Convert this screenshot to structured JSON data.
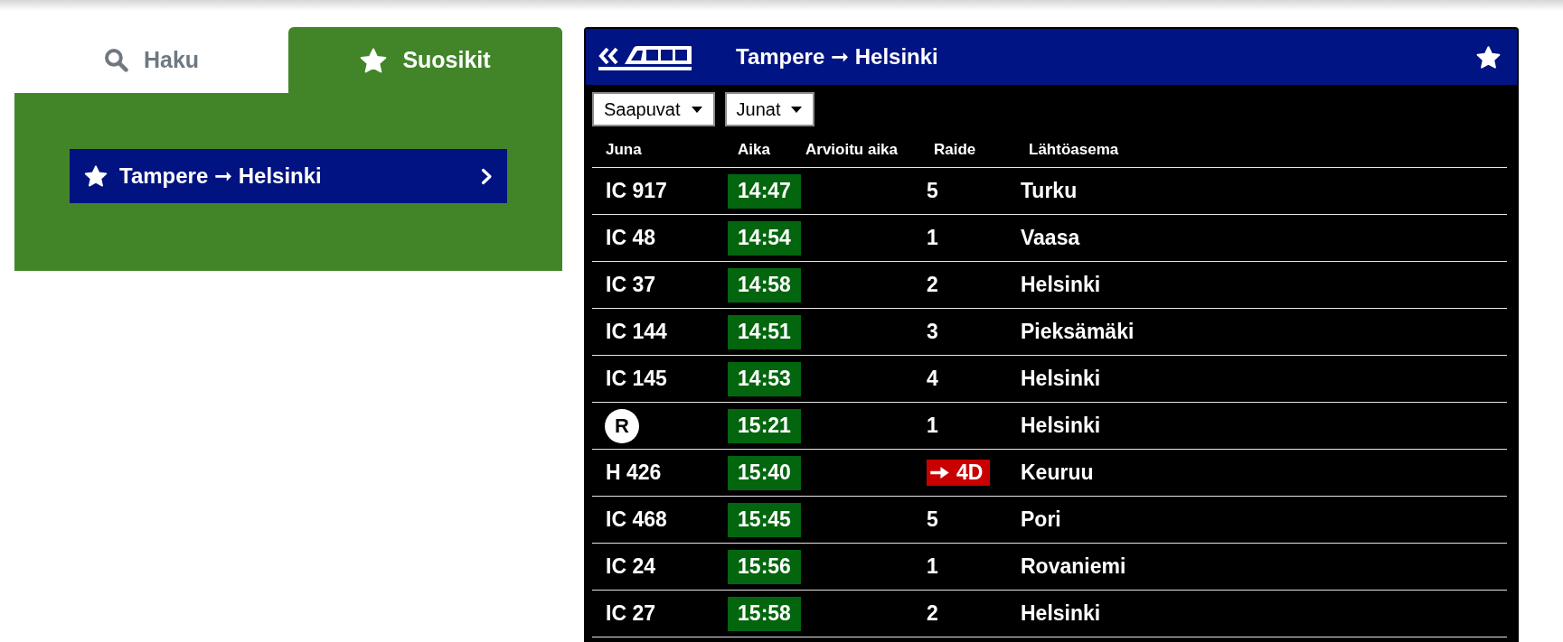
{
  "tabs": [
    {
      "label": "Haku",
      "kind": "search",
      "selected": false
    },
    {
      "label": "Suosikit",
      "kind": "favorites",
      "selected": true
    }
  ],
  "favorites": [
    {
      "label": "Tampere ➞ Helsinki"
    }
  ],
  "board": {
    "title": "Tampere ➞ Helsinki",
    "starred": true,
    "filters": [
      {
        "label": "Saapuvat"
      },
      {
        "label": "Junat"
      }
    ],
    "columns": [
      "Juna",
      "Aika",
      "Arvioitu aika",
      "Raide",
      "Lähtöasema"
    ],
    "rows": [
      {
        "train": "IC 917",
        "kind": "train",
        "time": "14:47",
        "platform": "5",
        "platform_changed": false,
        "origin": "Turku"
      },
      {
        "train": "IC 48",
        "kind": "train",
        "time": "14:54",
        "platform": "1",
        "platform_changed": false,
        "origin": "Vaasa"
      },
      {
        "train": "IC 37",
        "kind": "train",
        "time": "14:58",
        "platform": "2",
        "platform_changed": false,
        "origin": "Helsinki"
      },
      {
        "train": "IC 144",
        "kind": "train",
        "time": "14:51",
        "platform": "3",
        "platform_changed": false,
        "origin": "Pieksämäki"
      },
      {
        "train": "IC 145",
        "kind": "train",
        "time": "14:53",
        "platform": "4",
        "platform_changed": false,
        "origin": "Helsinki"
      },
      {
        "train": "R",
        "kind": "line",
        "time": "15:21",
        "platform": "1",
        "platform_changed": false,
        "origin": "Helsinki"
      },
      {
        "train": "H 426",
        "kind": "train",
        "time": "15:40",
        "platform": "4D",
        "platform_changed": true,
        "origin": "Keuruu"
      },
      {
        "train": "IC 468",
        "kind": "train",
        "time": "15:45",
        "platform": "5",
        "platform_changed": false,
        "origin": "Pori"
      },
      {
        "train": "IC 24",
        "kind": "train",
        "time": "15:56",
        "platform": "1",
        "platform_changed": false,
        "origin": "Rovaniemi"
      },
      {
        "train": "IC 27",
        "kind": "train",
        "time": "15:58",
        "platform": "2",
        "platform_changed": false,
        "origin": "Helsinki"
      }
    ]
  }
}
